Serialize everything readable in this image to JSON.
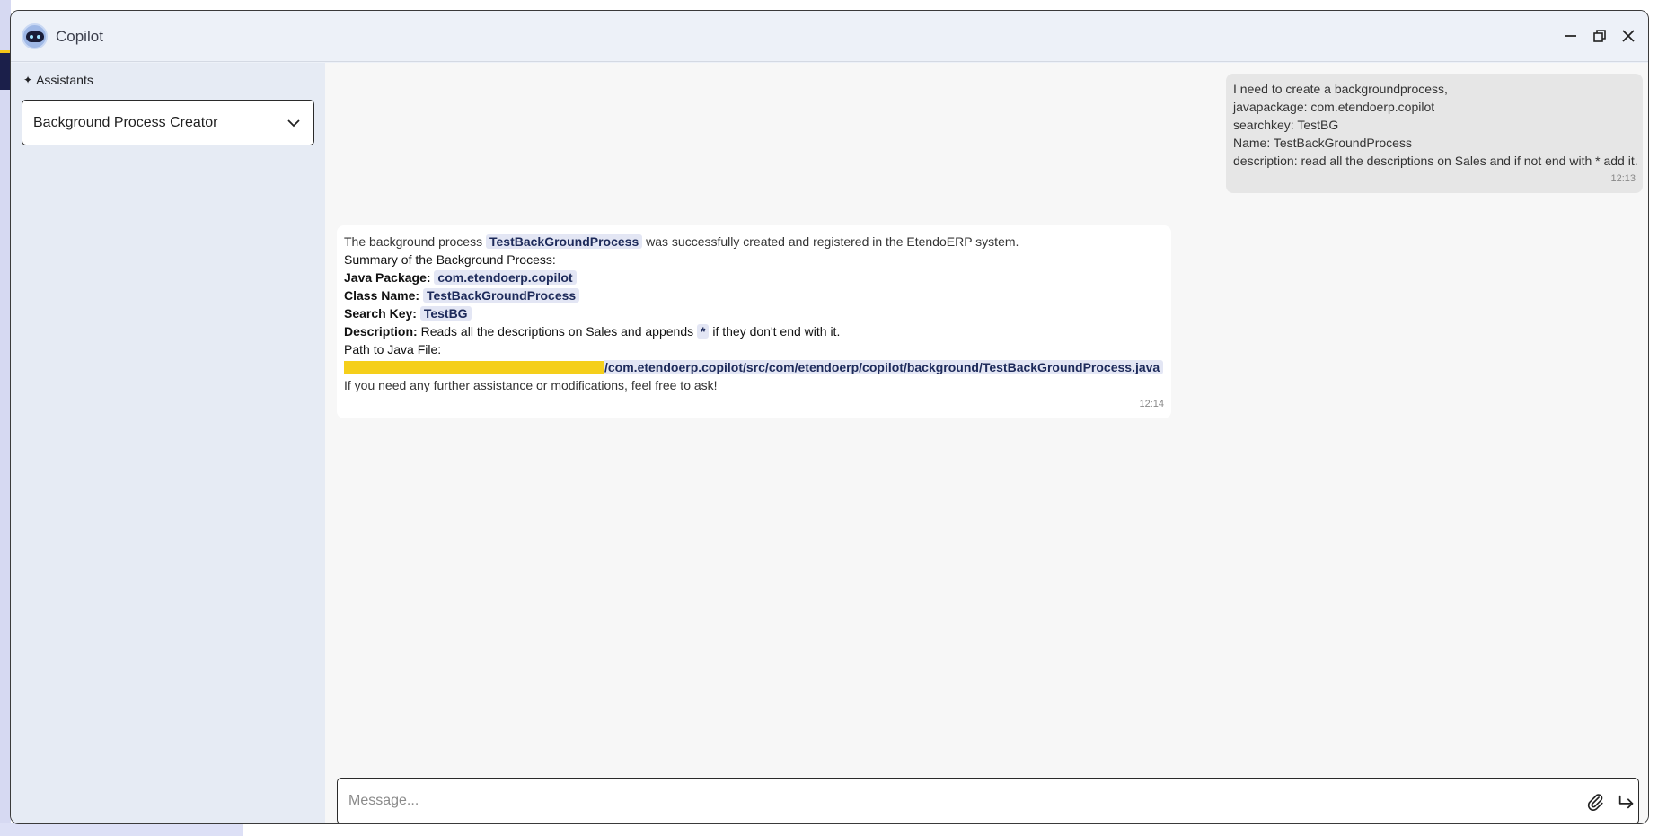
{
  "window": {
    "title": "Copilot"
  },
  "sidebar": {
    "assistants_label": "Assistants",
    "selected_assistant": "Background Process Creator"
  },
  "messages": {
    "user": {
      "lines": [
        "I need to create a backgroundprocess,",
        "javapackage: com.etendoerp.copilot",
        "searchkey: TestBG",
        "Name: TestBackGroundProcess",
        "description: read all the descriptions on Sales and if not end with * add it."
      ],
      "time": "12:13"
    },
    "bot": {
      "intro_prefix": "The background process",
      "intro_code": "TestBackGroundProcess",
      "intro_suffix": "was successfully created and registered in the EtendoERP system.",
      "summary_heading": "Summary of the Background Process:",
      "java_package_label": "Java Package:",
      "java_package_value": "com.etendoerp.copilot",
      "class_name_label": "Class Name:",
      "class_name_value": "TestBackGroundProcess",
      "search_key_label": "Search Key:",
      "search_key_value": "TestBG",
      "description_label": "Description:",
      "description_prefix": "Reads all the descriptions on Sales and appends",
      "description_code": "*",
      "description_suffix": "if they don't end with it.",
      "path_label": "Path to Java File:",
      "path_value": "/com.etendoerp.copilot/src/com/etendoerp/copilot/background/TestBackGroundProcess.java",
      "closing": "If you need any further assistance or modifications, feel free to ask!",
      "time": "12:14"
    }
  },
  "composer": {
    "placeholder": "Message..."
  },
  "colors": {
    "window_bg": "#edf1f8",
    "sidebar_bg": "#e6ebf4",
    "chat_bg": "#f7f7f7",
    "user_bubble": "#e6e6e6",
    "code_bg": "#e3e6f4",
    "redaction": "#f5cf1b"
  },
  "icons": [
    "copilot-logo-icon",
    "sparkle-icon",
    "minimize-icon",
    "restore-icon",
    "close-icon",
    "chevron-down-icon",
    "paperclip-icon",
    "send-icon"
  ]
}
